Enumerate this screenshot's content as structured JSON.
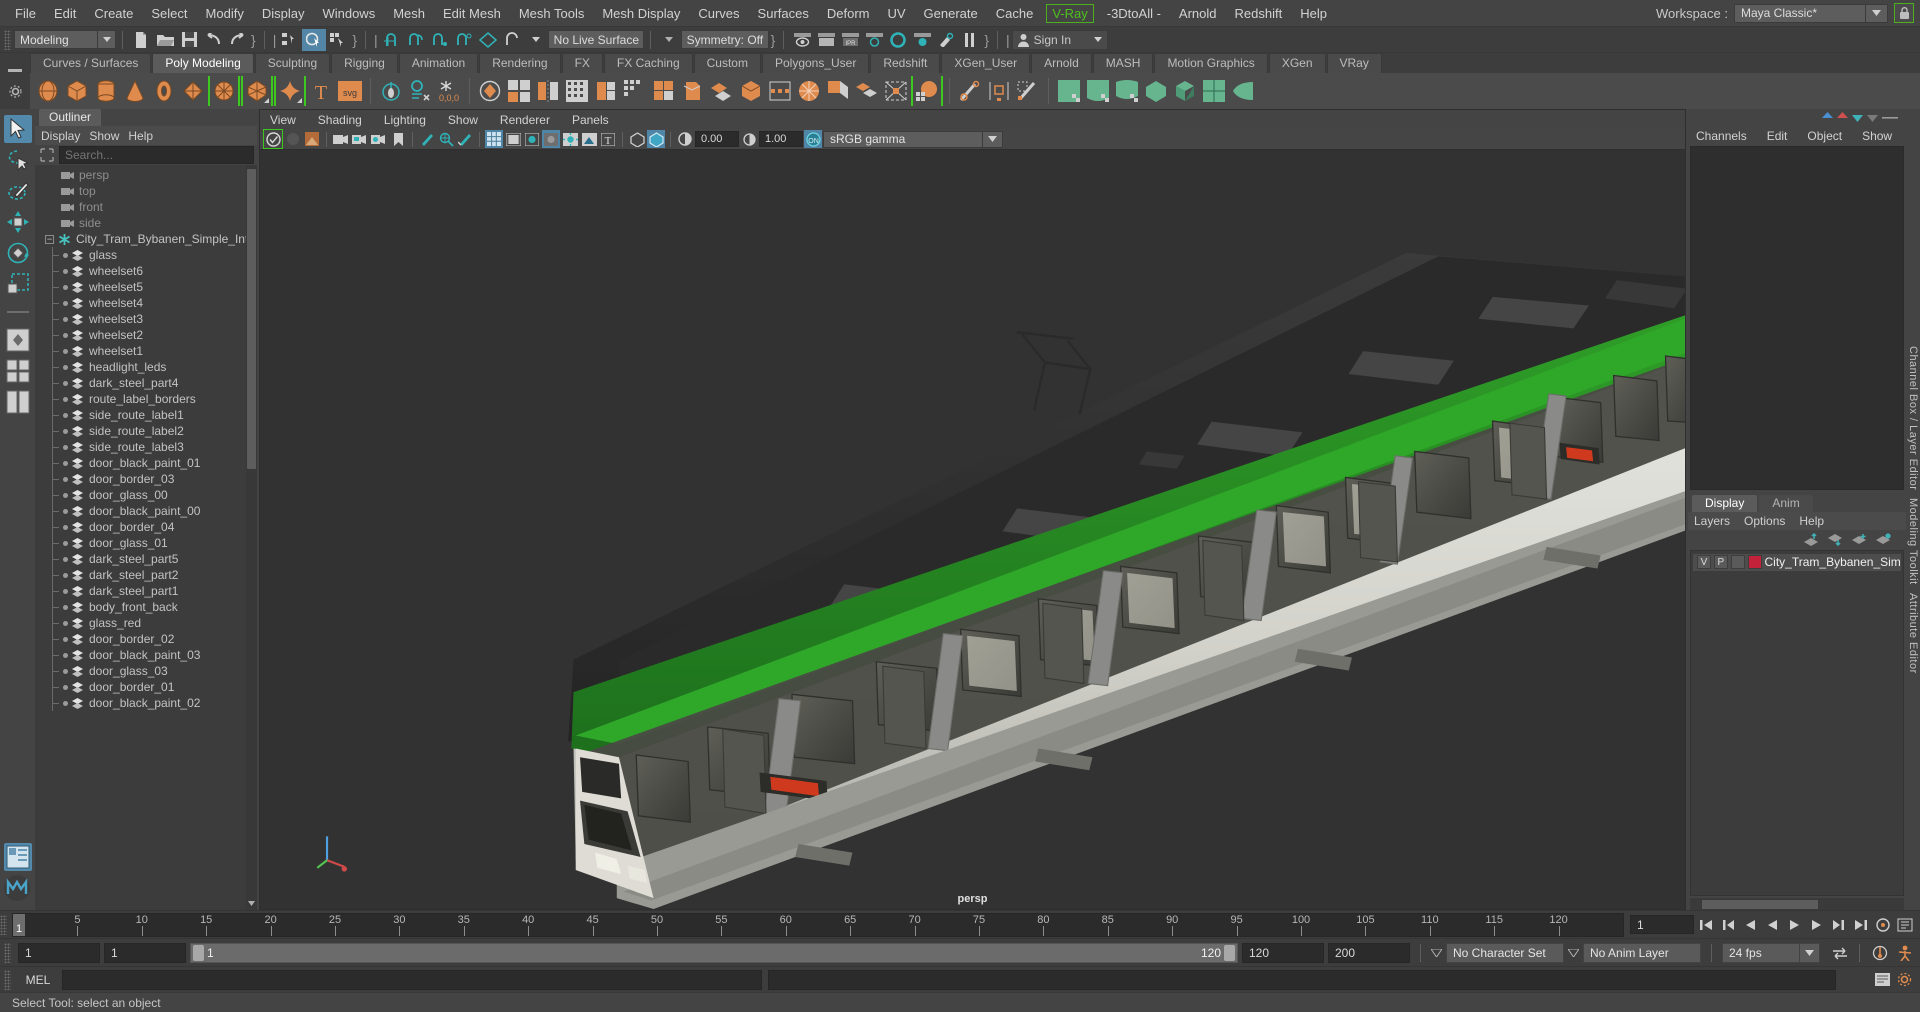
{
  "menubar": {
    "items": [
      "File",
      "Edit",
      "Create",
      "Select",
      "Modify",
      "Display",
      "Windows",
      "Mesh",
      "Edit Mesh",
      "Mesh Tools",
      "Mesh Display",
      "Curves",
      "Surfaces",
      "Deform",
      "UV",
      "Generate",
      "Cache"
    ],
    "highlighted": "V-Ray",
    "after_highlight": [
      "-3DtoAll -",
      "Arnold",
      "Redshift",
      "Help"
    ],
    "workspace_label": "Workspace :",
    "workspace_value": "Maya Classic*"
  },
  "statusline": {
    "mode": "Modeling",
    "live_surface": "No Live Surface",
    "symmetry": "Symmetry: Off",
    "signin": "Sign In"
  },
  "shelf": {
    "tabs": [
      "Curves / Surfaces",
      "Poly Modeling",
      "Sculpting",
      "Rigging",
      "Animation",
      "Rendering",
      "FX",
      "FX Caching",
      "Custom",
      "Polygons_User",
      "Redshift",
      "XGen_User",
      "Arnold",
      "MASH",
      "Motion Graphics",
      "XGen",
      "VRay"
    ],
    "active_tab": "Poly Modeling"
  },
  "outliner": {
    "title": "Outliner",
    "menus": [
      "Display",
      "Show",
      "Help"
    ],
    "search_placeholder": "Search...",
    "cameras": [
      "persp",
      "top",
      "front",
      "side"
    ],
    "root": "City_Tram_Bybanen_Simple_Interior_C",
    "children": [
      "glass",
      "wheelset6",
      "wheelset5",
      "wheelset4",
      "wheelset3",
      "wheelset2",
      "wheelset1",
      "headlight_leds",
      "dark_steel_part4",
      "route_label_borders",
      "side_route_label1",
      "side_route_label2",
      "side_route_label3",
      "door_black_paint_01",
      "door_border_03",
      "door_glass_00",
      "door_black_paint_00",
      "door_border_04",
      "door_glass_01",
      "dark_steel_part5",
      "dark_steel_part2",
      "dark_steel_part1",
      "body_front_back",
      "glass_red",
      "door_border_02",
      "door_black_paint_03",
      "door_glass_03",
      "door_border_01",
      "door_black_paint_02"
    ]
  },
  "viewport": {
    "menus": [
      "View",
      "Shading",
      "Lighting",
      "Show",
      "Renderer",
      "Panels"
    ],
    "exposure": "0.00",
    "gamma": "1.00",
    "color_profile": "sRGB gamma",
    "camera_label": "persp"
  },
  "channelbox": {
    "menus": [
      "Channels",
      "Edit",
      "Object",
      "Show"
    ],
    "sidebar_labels": [
      "Channel Box / Layer Editor",
      "Modeling Toolkit",
      "Attribute Editor"
    ]
  },
  "layereditor": {
    "tabs": [
      "Display",
      "Anim"
    ],
    "active_tab": "Display",
    "menus": [
      "Layers",
      "Options",
      "Help"
    ],
    "layers": [
      {
        "visible": "V",
        "playback": "P",
        "color": "#c4213a",
        "name": "City_Tram_Bybanen_Simple_Int"
      }
    ]
  },
  "timeline": {
    "current_frame": "1",
    "ticks": [
      "5",
      "10",
      "15",
      "20",
      "25",
      "30",
      "35",
      "40",
      "45",
      "50",
      "55",
      "60",
      "65",
      "70",
      "75",
      "80",
      "85",
      "90",
      "95",
      "100",
      "105",
      "110",
      "115",
      "120"
    ],
    "frame_field": "1"
  },
  "rangerow": {
    "start": "1",
    "anim_start": "1",
    "range_start": "1",
    "range_end": "120",
    "playback_end": "120",
    "anim_end": "200",
    "character_set": "No Character Set",
    "anim_layer": "No Anim Layer",
    "fps": "24 fps"
  },
  "commandline": {
    "language": "MEL",
    "input_value": ""
  },
  "helpline": {
    "text": "Select Tool: select an object"
  },
  "colors": {
    "accent_green": "#3cc81e",
    "accent_blue": "#5285a6",
    "shelf_orange": "#e08b4e",
    "teal": "#2fb3b8",
    "layer_red": "#c4213a"
  }
}
